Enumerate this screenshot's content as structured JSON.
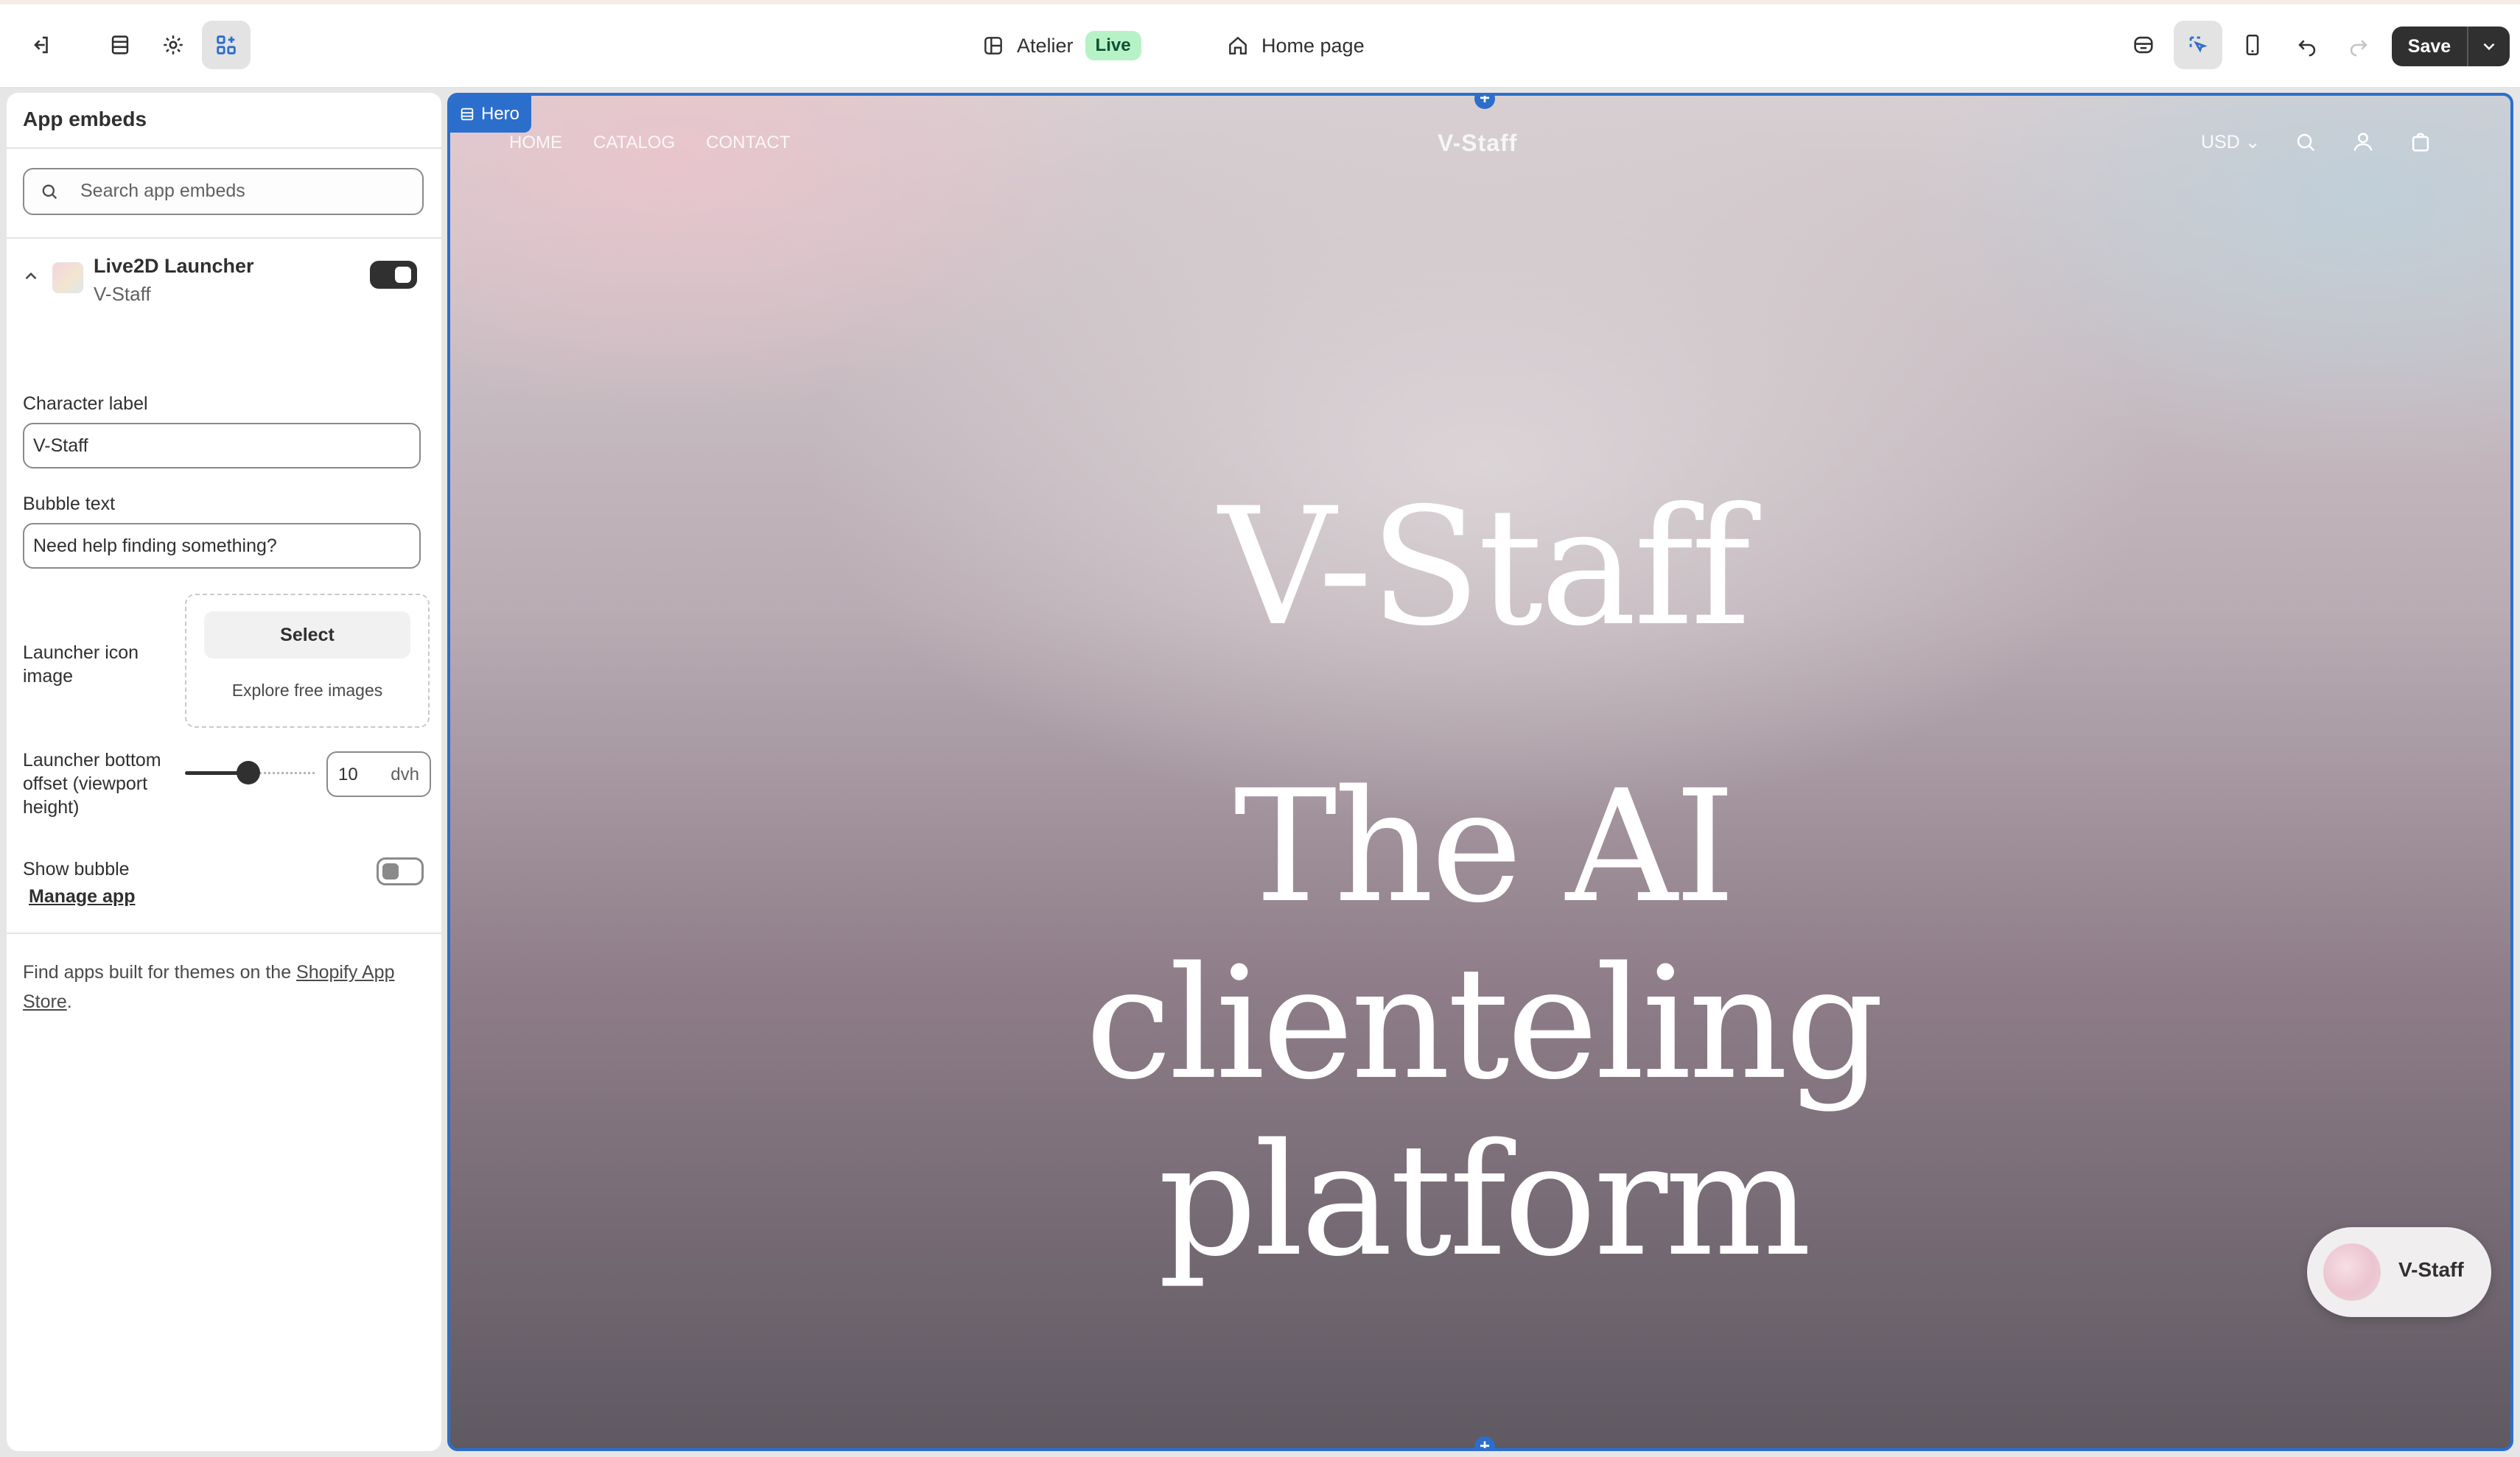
{
  "topbar": {
    "theme_name": "Atelier",
    "theme_status": "Live",
    "page_name": "Home page",
    "save_label": "Save"
  },
  "panel": {
    "title": "App embeds",
    "search_placeholder": "Search app embeds",
    "embed": {
      "name": "Live2D Launcher",
      "vendor": "V-Staff",
      "enabled": true
    },
    "fields": {
      "character_label": {
        "label": "Character label",
        "value": "V-Staff"
      },
      "bubble_text": {
        "label": "Bubble text",
        "value": "Need help finding something?"
      },
      "launcher_icon": {
        "label": "Launcher icon image",
        "select_label": "Select",
        "explore_label": "Explore free images"
      },
      "bottom_offset": {
        "label": "Launcher bottom offset (viewport height)",
        "value": "10",
        "unit": "dvh"
      },
      "show_bubble": {
        "label": "Show bubble",
        "enabled": false
      }
    },
    "manage_app": "Manage app",
    "footer": {
      "prefix": "Find apps built for themes on the ",
      "link": "Shopify App Store",
      "suffix": "."
    }
  },
  "preview": {
    "section_tag": "Hero",
    "nav": [
      "HOME",
      "CATALOG",
      "CONTACT"
    ],
    "logo": "V-Staff",
    "currency": "USD",
    "hero_title": "V-Staff",
    "hero_subtitle": "The AI clienteling platform",
    "launcher_label": "V-Staff"
  },
  "colors": {
    "accent": "#2c6ecb",
    "dark": "#303030",
    "live_bg": "#b7f2c7"
  }
}
